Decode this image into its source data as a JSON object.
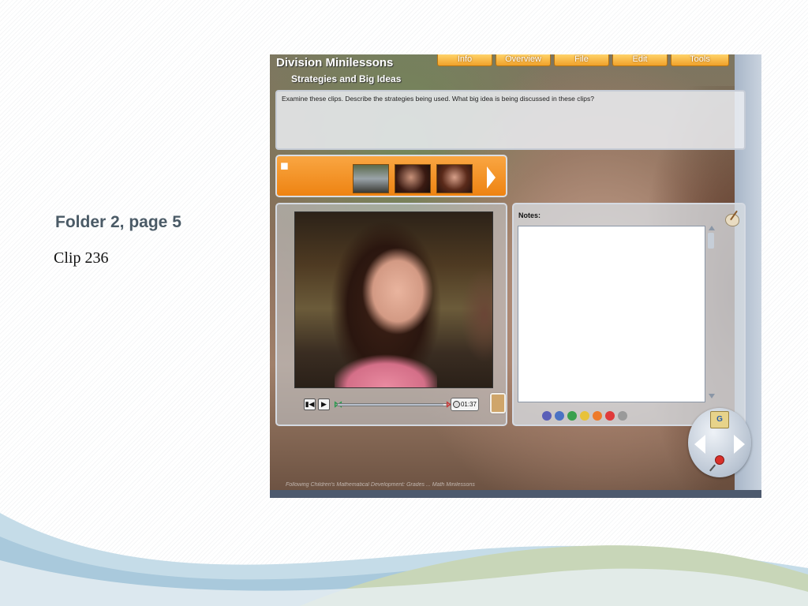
{
  "slide": {
    "title": "Folder 2, page 5",
    "body": "Clip 236"
  },
  "app": {
    "title": "Division Minilessons",
    "subtitle": "Strategies and Big Ideas",
    "menu": {
      "info": "Info",
      "overview": "Overview",
      "file": "File",
      "edit": "Edit",
      "tools": "Tools"
    },
    "prompt": "Examine these clips. Describe the strategies being used. What big idea is being discussed in these clips?",
    "player": {
      "timecode": "01:37",
      "progress_fraction": 0.97
    },
    "notes": {
      "label": "Notes:",
      "value": ""
    },
    "color_dots": [
      "#5a5fb8",
      "#4a72c4",
      "#3aa04e",
      "#e8c23a",
      "#ee7a2a",
      "#e03a3a",
      "#9a9a9a"
    ],
    "nav": {
      "folder_letter": "G"
    },
    "credits": "Following Children's Mathematical Development: Grades ... Math Minilessons"
  }
}
